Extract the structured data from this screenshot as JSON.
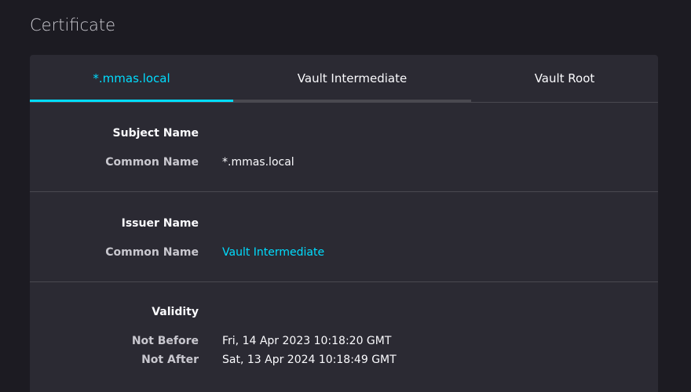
{
  "page": {
    "title": "Certificate"
  },
  "tabs": [
    {
      "label": "*.mmas.local",
      "selected": true
    },
    {
      "label": "Vault Intermediate",
      "selected": false
    },
    {
      "label": "Vault Root",
      "selected": false
    }
  ],
  "subject": {
    "heading": "Subject Name",
    "common_name_label": "Common Name",
    "common_name_value": "*.mmas.local"
  },
  "issuer": {
    "heading": "Issuer Name",
    "common_name_label": "Common Name",
    "common_name_value": "Vault Intermediate"
  },
  "validity": {
    "heading": "Validity",
    "not_before_label": "Not Before",
    "not_before_value": "Fri, 14 Apr 2023 10:18:20 GMT",
    "not_after_label": "Not After",
    "not_after_value": "Sat, 13 Apr 2024 10:18:49 GMT"
  },
  "colors": {
    "accent": "#00ddff",
    "background": "#1c1b22",
    "card": "#2b2a33",
    "divider": "#4a4950"
  }
}
